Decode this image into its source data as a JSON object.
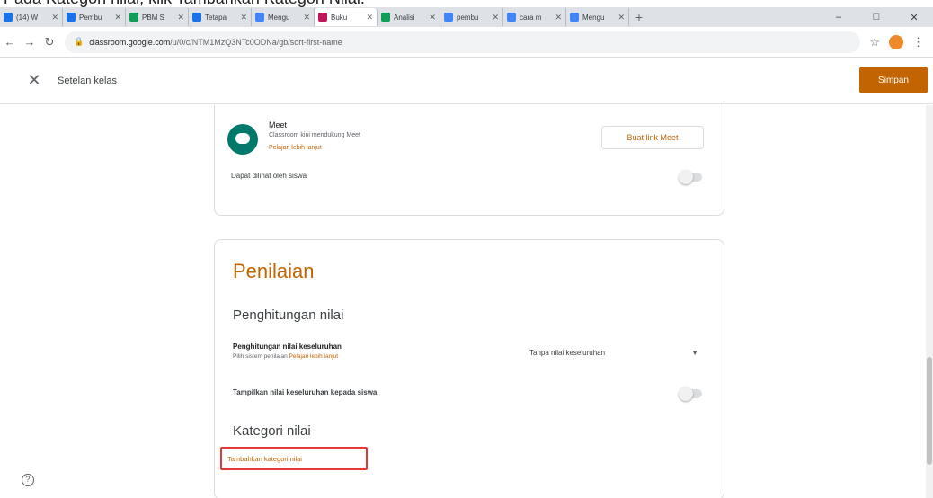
{
  "caption": "Pada Kategori nilai, klik Tambahkan Kategori Nilai.",
  "browser": {
    "tabs": [
      {
        "label": "(14) W",
        "fav": "#1a73e8",
        "active": false
      },
      {
        "label": "Pembu",
        "fav": "#1a73e8",
        "active": false
      },
      {
        "label": "PBM S",
        "fav": "#0f9d58",
        "active": false
      },
      {
        "label": "Tetapa",
        "fav": "#1a73e8",
        "active": false
      },
      {
        "label": "Mengu",
        "fav": "#4285f4",
        "active": false
      },
      {
        "label": "Buku",
        "fav": "#c2185b",
        "active": true
      },
      {
        "label": "Analisi",
        "fav": "#0f9d58",
        "active": false
      },
      {
        "label": "pembu",
        "fav": "#4285f4",
        "active": false
      },
      {
        "label": "cara m",
        "fav": "#4285f4",
        "active": false
      },
      {
        "label": "Mengu",
        "fav": "#4285f4",
        "active": false
      }
    ],
    "url_host": "classroom.google.com",
    "url_path": "/u/0/c/NTM1MzQ3NTc0ODNa/gb/sort-first-name"
  },
  "header": {
    "title": "Setelan kelas",
    "save_label": "Simpan"
  },
  "meet": {
    "title": "Meet",
    "description": "Classroom kini mendukung Meet",
    "learn_more": "Pelajari lebih lanjut",
    "button": "Buat link Meet",
    "visible_label": "Dapat dilihat oleh siswa"
  },
  "grading": {
    "title": "Penilaian",
    "calc_section": "Penghitungan nilai",
    "calc_label": "Penghitungan nilai keseluruhan",
    "calc_sub": "Pilih sistem penilaian",
    "calc_link": "Pelajari lebih lanjut",
    "calc_value": "Tanpa nilai keseluruhan",
    "show_label": "Tampilkan nilai keseluruhan kepada siswa",
    "category_section": "Kategori nilai",
    "add_category": "Tambahkan kategori nilai"
  }
}
